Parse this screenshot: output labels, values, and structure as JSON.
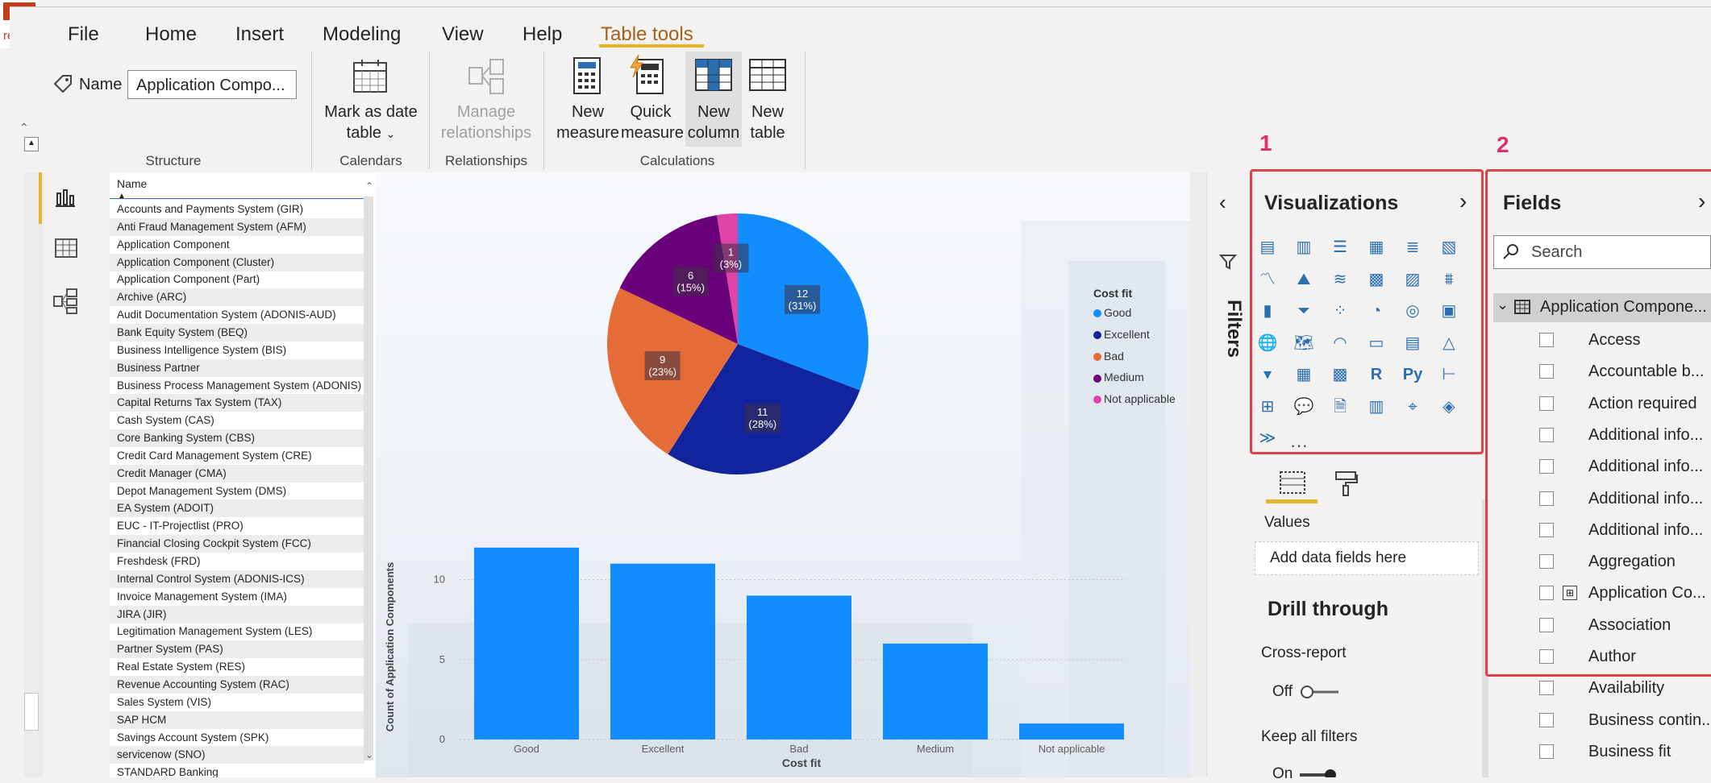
{
  "app": {
    "corner_text": "re",
    "close_glyph": "×"
  },
  "ribbon": {
    "tabs": [
      "File",
      "Home",
      "Insert",
      "Modeling",
      "View",
      "Help",
      "Table tools"
    ],
    "name_label": "Name",
    "name_value": "Application Compo...",
    "structure_label": "Structure",
    "mark_as_date_line1": "Mark as date",
    "mark_as_date_line2": "table",
    "calendars_label": "Calendars",
    "manage_rel_line1": "Manage",
    "manage_rel_line2": "relationships",
    "relationships_label": "Relationships",
    "new_measure_line1": "New",
    "new_measure_line2": "measure",
    "quick_measure_line1": "Quick",
    "quick_measure_line2": "measure",
    "new_column_line1": "New",
    "new_column_line2": "column",
    "new_table_line1": "New",
    "new_table_line2": "table",
    "calculations_label": "Calculations"
  },
  "table": {
    "header": "Name",
    "rows": [
      "Accounts and Payments System (GIR)",
      "Anti Fraud Management System (AFM)",
      "Application Component",
      "Application Component (Cluster)",
      "Application Component (Part)",
      "Archive (ARC)",
      "Audit Documentation System (ADONIS-AUD)",
      "Bank Equity System (BEQ)",
      "Business Intelligence System (BIS)",
      "Business Partner",
      "Business Process Management System (ADONIS)",
      "Capital Returns Tax System (TAX)",
      "Cash System (CAS)",
      "Core Banking System (CBS)",
      "Credit Card Management System (CRE)",
      "Credit Manager (CMA)",
      "Depot Management System (DMS)",
      "EA System (ADOIT)",
      "EUC - IT-Projectlist (PRO)",
      "Financial Closing Cockpit System (FCC)",
      "Freshdesk (FRD)",
      "Internal Control System (ADONIS-ICS)",
      "Invoice Management System (IMA)",
      "JIRA (JIR)",
      "Legitimation Management System (LES)",
      "Partner System (PAS)",
      "Real Estate System (RES)",
      "Revenue Accounting System (RAC)",
      "Sales System (VIS)",
      "SAP HCM",
      "Savings Account System (SPK)",
      "servicenow (SNO)",
      "STANDARD Banking"
    ]
  },
  "chart_data": [
    {
      "type": "pie",
      "legend_title": "Cost fit",
      "categories": [
        "Good",
        "Excellent",
        "Bad",
        "Medium",
        "Not applicable"
      ],
      "values": [
        12,
        11,
        9,
        6,
        1
      ],
      "labels": [
        {
          "count": "12",
          "pct": "(31%)"
        },
        {
          "count": "11",
          "pct": "(28%)"
        },
        {
          "count": "9",
          "pct": "(23%)"
        },
        {
          "count": "6",
          "pct": "(15%)"
        },
        {
          "count": "1",
          "pct": "(3%)"
        }
      ],
      "colors": [
        "#118dff",
        "#12239e",
        "#e66c37",
        "#6b007b",
        "#e044a7"
      ],
      "legend_placement": "right"
    },
    {
      "type": "bar",
      "categories": [
        "Good",
        "Excellent",
        "Bad",
        "Medium",
        "Not applicable"
      ],
      "values": [
        12,
        11,
        9,
        6,
        1
      ],
      "xlabel": "Cost fit",
      "ylabel": "Count of Application Components",
      "yticks": [
        "0",
        "5",
        "10"
      ],
      "ylim": [
        0,
        13
      ],
      "color": "#118dff",
      "grid": true
    }
  ],
  "filters": {
    "label": "Filters"
  },
  "viz": {
    "badge": "1",
    "title": "Visualizations",
    "values_label": "Values",
    "add_fields_placeholder": "Add data fields here",
    "drill_title": "Drill through",
    "cross_report_label": "Cross-report",
    "off_label": "Off",
    "keep_filters_label": "Keep all filters",
    "on_label": "On",
    "more_label": "···"
  },
  "fields": {
    "badge": "2",
    "title": "Fields",
    "search_placeholder": "Search",
    "table_name": "Application Compone...",
    "items": [
      "Access",
      "Accountable b...",
      "Action required",
      "Additional info...",
      "Additional info...",
      "Additional info...",
      "Additional info...",
      "Aggregation",
      "Application Co...",
      "Association",
      "Author",
      "Availability",
      "Business contin...",
      "Business fit"
    ]
  }
}
